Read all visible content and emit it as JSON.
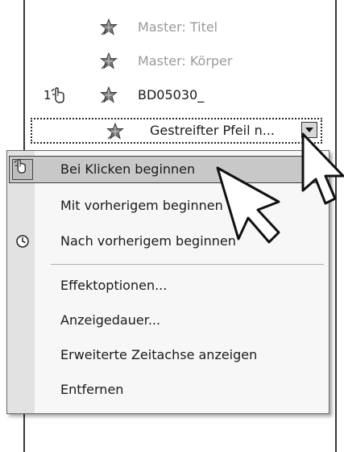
{
  "task_list": {
    "items": [
      {
        "number": "",
        "label": "Master: Titel",
        "dimmed": true,
        "icon": "motion-path-star-icon"
      },
      {
        "number": "",
        "label": "Master: Körper",
        "dimmed": true,
        "icon": "motion-path-star-icon"
      },
      {
        "number": "1",
        "label": "BD05030_",
        "dimmed": false,
        "icon": "motion-path-star-icon",
        "trigger_icon": "mouse-click-icon"
      }
    ],
    "selected_item": {
      "label": "Gestreifter Pfeil n...",
      "icon": "motion-path-star-icon"
    }
  },
  "context_menu": {
    "items": [
      {
        "label": "Bei Klicken beginnen",
        "icon": "mouse-click-icon",
        "highlighted": true
      },
      {
        "label": "Mit vorherigem beginnen",
        "icon": "",
        "highlighted": false
      },
      {
        "label": "Nach vorherigem beginnen",
        "icon": "clock-icon",
        "highlighted": false
      },
      {
        "label": "Effektoptionen...",
        "icon": "",
        "highlighted": false
      },
      {
        "label": "Anzeigedauer...",
        "icon": "",
        "highlighted": false
      },
      {
        "label": "Erweiterte Zeitachse anzeigen",
        "icon": "",
        "highlighted": false
      },
      {
        "label": "Entfernen",
        "icon": "",
        "highlighted": false
      }
    ]
  },
  "colors": {
    "highlight": "#c8c8c8",
    "dimmed_text": "#9a9a9a",
    "menu_bg": "#f7f7f7"
  }
}
